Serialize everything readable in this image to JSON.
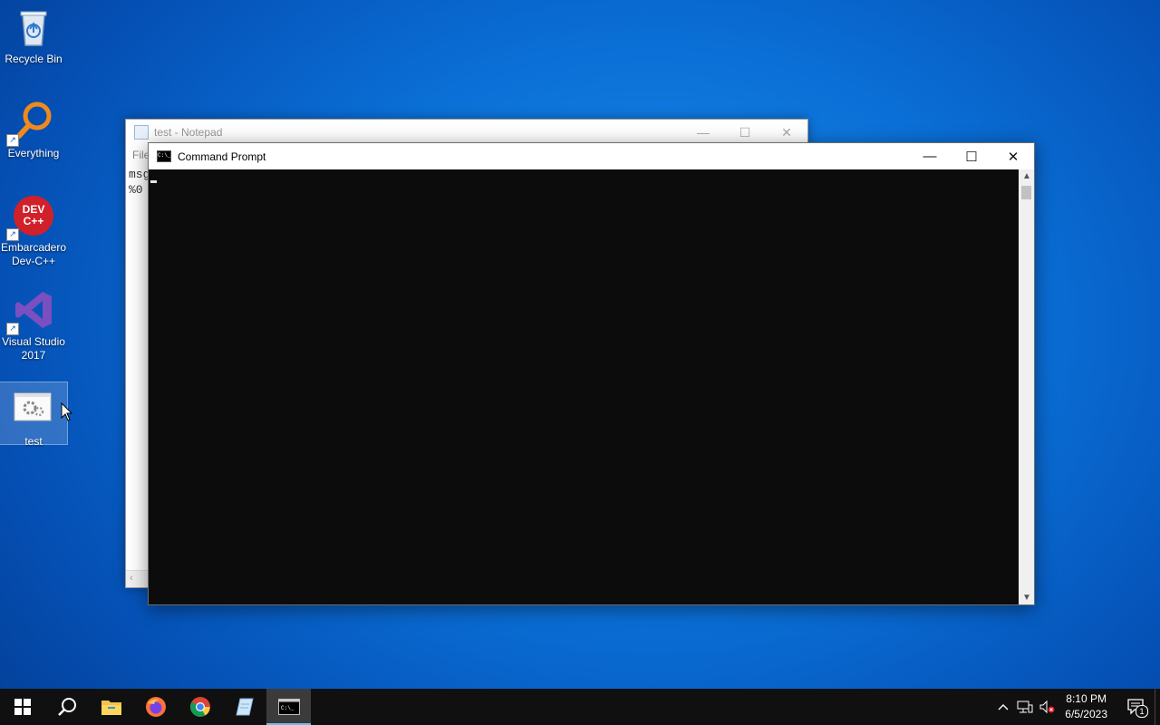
{
  "desktop": {
    "icons": [
      {
        "label": "Recycle Bin"
      },
      {
        "label": "Everything"
      },
      {
        "label": "Embarcadero Dev-C++",
        "glyph_text": "DEV C++"
      },
      {
        "label": "Visual Studio 2017"
      },
      {
        "label": "test"
      }
    ]
  },
  "notepad": {
    "title": "test - Notepad",
    "menu_partial": "File",
    "lines": [
      "msg",
      "%0"
    ],
    "controls": {
      "minimize": "—",
      "maximize": "☐",
      "close": "✕"
    }
  },
  "cmd": {
    "title": "Command Prompt",
    "icon_text": "C:\\_",
    "controls": {
      "minimize": "—",
      "maximize": "☐",
      "close": "✕"
    }
  },
  "taskbar": {
    "items": [
      "start-button",
      "search-button",
      "file-explorer",
      "firefox",
      "chrome",
      "notepad",
      "command-prompt"
    ],
    "active": "command-prompt",
    "clock": {
      "time": "8:10 PM",
      "date": "6/5/2023"
    },
    "notification_count": "1"
  },
  "colors": {
    "taskbar": "#101010",
    "console_bg": "#0c0c0c",
    "accent": "#76b9ed"
  }
}
